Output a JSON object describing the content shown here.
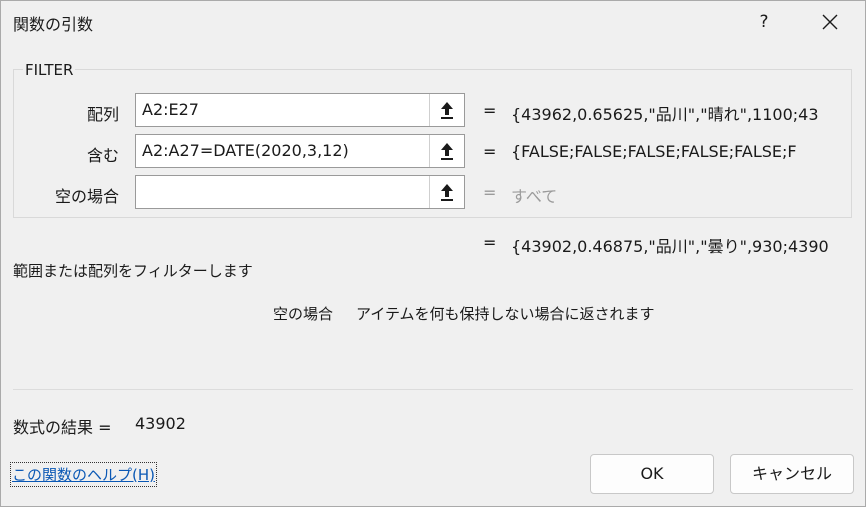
{
  "window": {
    "title": "関数の引数",
    "help_label": "?"
  },
  "function": {
    "name": "FILTER",
    "arguments": [
      {
        "label": "配列",
        "value": "A2:E27",
        "equals": "=",
        "result": "{43962,0.65625,\"品川\",\"晴れ\",1100;43",
        "result_gray": false
      },
      {
        "label": "含む",
        "value": "A2:A27=DATE(2020,3,12)",
        "equals": "=",
        "result": "{FALSE;FALSE;FALSE;FALSE;FALSE;F",
        "result_gray": false
      },
      {
        "label": "空の場合",
        "value": "",
        "equals": "=",
        "result": "すべて",
        "result_gray": true
      }
    ],
    "overall_equals": "=",
    "overall_result": "{43902,0.46875,\"品川\",\"曇り\",930;4390",
    "description": "範囲または配列をフィルターします",
    "arg_description_name": "空の場合",
    "arg_description_text": "アイテムを何も保持しない場合に返されます"
  },
  "formula_result": {
    "label": "数式の結果 =",
    "value": "43902"
  },
  "footer": {
    "help_link": "この関数のヘルプ(H)",
    "ok_label": "OK",
    "cancel_label": "キャンセル"
  },
  "icons": {
    "close": "close-icon",
    "range_select": "range-select-arrow-icon"
  },
  "colors": {
    "link": "#0a58b5",
    "muted_result": "#9b9b9b",
    "background": "#f0f0f0"
  }
}
